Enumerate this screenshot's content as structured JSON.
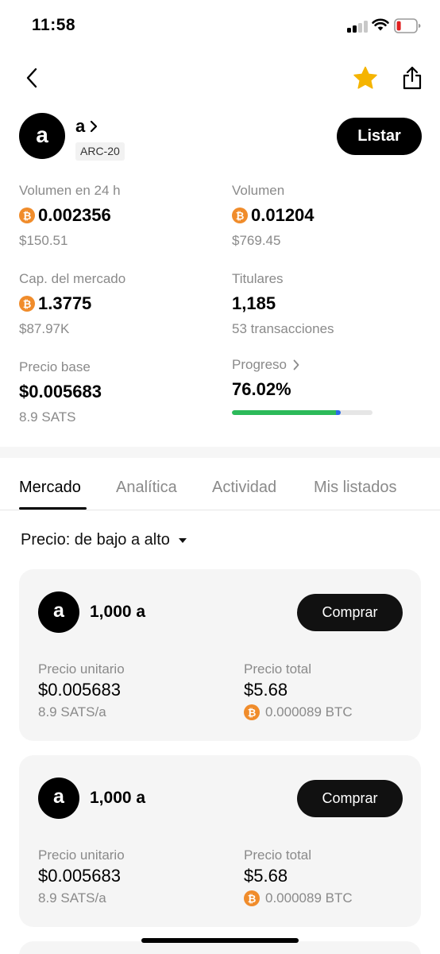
{
  "status_bar": {
    "time": "11:58"
  },
  "token": {
    "avatar_letter": "a",
    "name": "a",
    "badge": "ARC-20",
    "list_label": "Listar"
  },
  "stats": {
    "volume_24h": {
      "label": "Volumen en 24 h",
      "value": "0.002356",
      "sub": "$150.51"
    },
    "volume": {
      "label": "Volumen",
      "value": "0.01204",
      "sub": "$769.45"
    },
    "market_cap": {
      "label": "Cap. del mercado",
      "value": "1.3775",
      "sub": "$87.97K"
    },
    "holders": {
      "label": "Titulares",
      "value": "1,185",
      "sub": "53 transacciones"
    },
    "base_price": {
      "label": "Precio base",
      "value": "$0.005683",
      "sub": "8.9 SATS"
    },
    "progress": {
      "label": "Progreso",
      "value": "76.02%",
      "percent": 76.02
    }
  },
  "tabs": [
    {
      "label": "Mercado",
      "active": true
    },
    {
      "label": "Analítica",
      "active": false
    },
    {
      "label": "Actividad",
      "active": false
    },
    {
      "label": "Mis listados",
      "active": false
    }
  ],
  "sort": {
    "label": "Precio: de bajo a alto"
  },
  "listings": [
    {
      "avatar_letter": "a",
      "amount": "1,000 a",
      "buy_label": "Comprar",
      "unit_price_label": "Precio unitario",
      "unit_price": "$0.005683",
      "unit_price_sats": "8.9 SATS/a",
      "total_price_label": "Precio total",
      "total_price": "$5.68",
      "total_price_btc": "0.000089 BTC"
    },
    {
      "avatar_letter": "a",
      "amount": "1,000 a",
      "buy_label": "Comprar",
      "unit_price_label": "Precio unitario",
      "unit_price": "$0.005683",
      "unit_price_sats": "8.9 SATS/a",
      "total_price_label": "Precio total",
      "total_price": "$5.68",
      "total_price_btc": "0.000089 BTC"
    }
  ],
  "icons": {
    "btc_symbol": "₿",
    "star_color": "#f5b400",
    "btc_color": "#f08c2b",
    "progress_color": "#2cba5a",
    "progress_tip_color": "#2b6be6"
  }
}
